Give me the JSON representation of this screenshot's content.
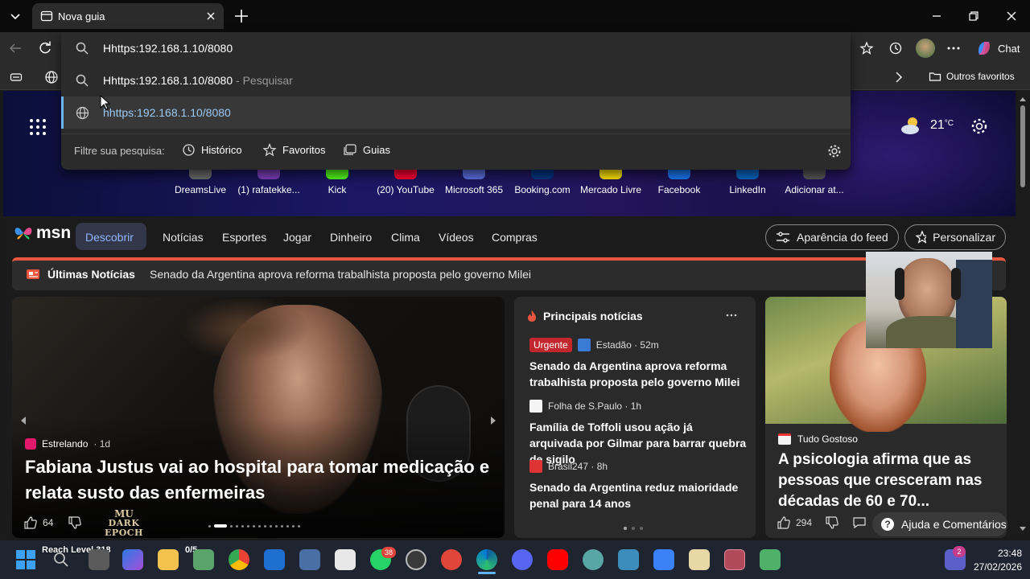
{
  "browser": {
    "tab_title": "Nova guia",
    "address": "Hhttps:192.168.1.10/8080",
    "chat_label": "Chat",
    "other_favorites": "Outros favoritos"
  },
  "dropdown": {
    "suggestion_search": "Hhttps:192.168.1.10/8080",
    "suggestion_search_suffix": " - Pesquisar",
    "suggestion_url": "hhttps:192.168.1.10/8080",
    "filter_label": "Filtre sua pesquisa:",
    "filters": [
      "Histórico",
      "Favoritos",
      "Guias"
    ]
  },
  "weather": {
    "temp": "21",
    "unit": "°C"
  },
  "tiles": [
    "DreamsLive",
    "(1) rafatekke...",
    "Kick",
    "(20) YouTube",
    "Microsoft 365",
    "Booking.com",
    "Mercado Livre",
    "Facebook",
    "LinkedIn",
    "Adicionar at..."
  ],
  "msn": {
    "logo": "msn",
    "nav": [
      "Descobrir",
      "Notícias",
      "Esportes",
      "Jogar",
      "Dinheiro",
      "Clima",
      "Vídeos",
      "Compras"
    ],
    "feed_button": "Aparência do feed",
    "personalize_button": "Personalizar"
  },
  "breaking": {
    "label": "Últimas Notícias",
    "headline": "Senado da Argentina aprova reforma trabalhista proposta pelo governo Milei"
  },
  "hero": {
    "source": "Estrelando",
    "age": "· 1d",
    "headline": "Fabiana Justus vai ao hospital para tomar medicação e relata susto das enfermeiras",
    "likes": "64",
    "game_logo_top": "MU",
    "game_logo_bottom": "DARK EPOCH"
  },
  "top_news": {
    "title": "Principais notícias",
    "items": [
      {
        "badge": "Urgente",
        "source": "Estadão · 52m",
        "headline": "Senado da Argentina aprova reforma trabalhista proposta pelo governo Milei"
      },
      {
        "badge": "",
        "source": "Folha de S.Paulo · 1h",
        "headline": "Família de Toffoli usou ação já arquivada por Gilmar para barrar quebra de sigilo"
      },
      {
        "badge": "",
        "source": "Brasil247 · 8h",
        "headline": "Senado da Argentina reduz maioridade penal para 14 anos"
      }
    ]
  },
  "side_card": {
    "source": "Tudo Gostoso",
    "headline": "A psicologia afirma que as pessoas que cresceram nas décadas de 60 e 70...",
    "likes": "294",
    "help_button": "Ajuda e Comentários"
  },
  "taskbar": {
    "game_overlay": "Reach Level 318",
    "game_count": "0/5",
    "whatsapp_badge": "38",
    "teams_badge": "2",
    "time": "23:48",
    "date": "27/02/2026",
    "accent": "#0078d4"
  }
}
